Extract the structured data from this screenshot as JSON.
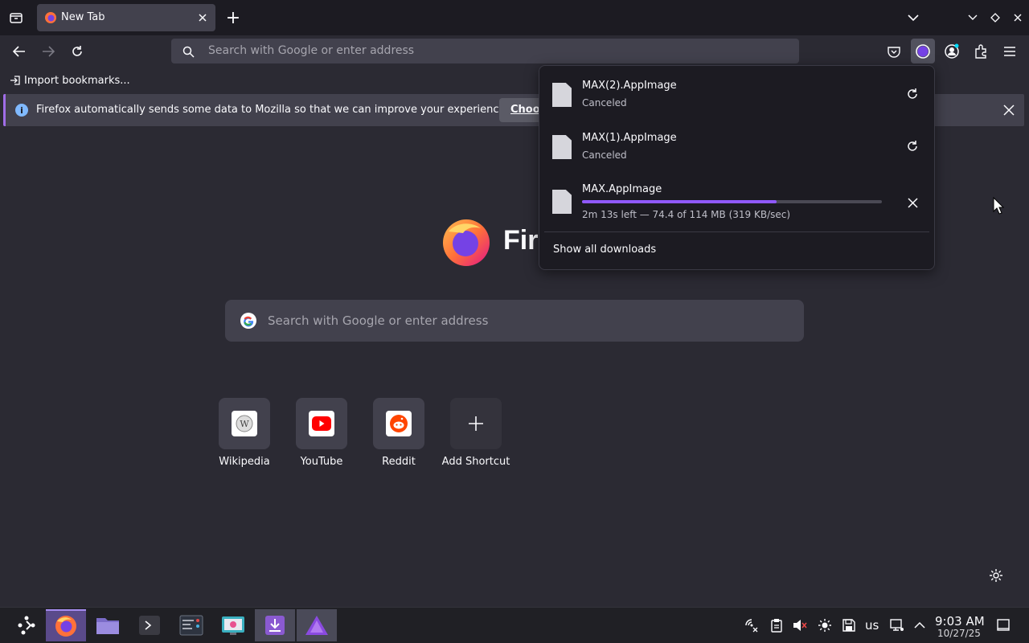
{
  "tabstrip": {
    "tab_title": "New Tab",
    "new_tab_label": "+"
  },
  "navbar": {
    "url_placeholder": "Search with Google or enter address"
  },
  "bookmarks": {
    "import_label": "Import bookmarks..."
  },
  "notification": {
    "text": "Firefox automatically sends some data to Mozilla so that we can improve your experience.",
    "button_label": "Choos"
  },
  "newtab": {
    "brand": "Firefox",
    "search_placeholder": "Search with Google or enter address",
    "shortcuts": [
      {
        "label": "Wikipedia",
        "icon": "wikipedia-icon"
      },
      {
        "label": "YouTube",
        "icon": "youtube-icon"
      },
      {
        "label": "Reddit",
        "icon": "reddit-icon"
      },
      {
        "label": "Add Shortcut",
        "icon": "plus-icon"
      }
    ]
  },
  "downloads": {
    "items": [
      {
        "name": "MAX(2).AppImage",
        "status": "Canceled",
        "action": "retry"
      },
      {
        "name": "MAX(1).AppImage",
        "status": "Canceled",
        "action": "retry"
      },
      {
        "name": "MAX.AppImage",
        "status": "2m 13s left — 74.4 of 114 MB (319 KB/sec)",
        "action": "cancel",
        "progress": 0.65
      }
    ],
    "show_all_label": "Show all downloads"
  },
  "taskbar": {
    "keyboard_layout": "us",
    "time": "9:03 AM",
    "date": "10/27/25"
  },
  "colors": {
    "accent": "#9059ff",
    "panel_bg": "#1c1b22",
    "page_bg": "#2b2a33"
  }
}
